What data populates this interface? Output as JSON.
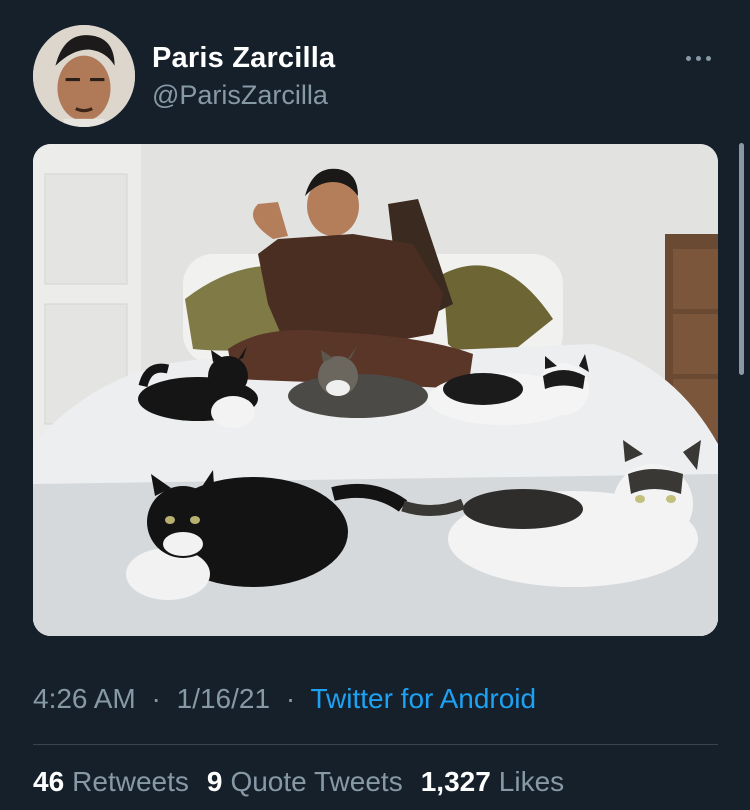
{
  "author": {
    "display_name": "Paris Zarcilla",
    "handle": "@ParisZarcilla"
  },
  "meta": {
    "time": "4:26 AM",
    "date": "1/16/21",
    "separator": "·",
    "source": "Twitter for Android"
  },
  "stats": [
    {
      "count": "46",
      "label": "Retweets"
    },
    {
      "count": "9",
      "label": "Quote Tweets"
    },
    {
      "count": "1,327",
      "label": "Likes"
    }
  ],
  "icons": {
    "more": "more-horizontal-icon"
  },
  "colors": {
    "background": "#15202b",
    "secondary_text": "#8899a6",
    "link": "#1da1f2",
    "divider": "#38444d"
  }
}
